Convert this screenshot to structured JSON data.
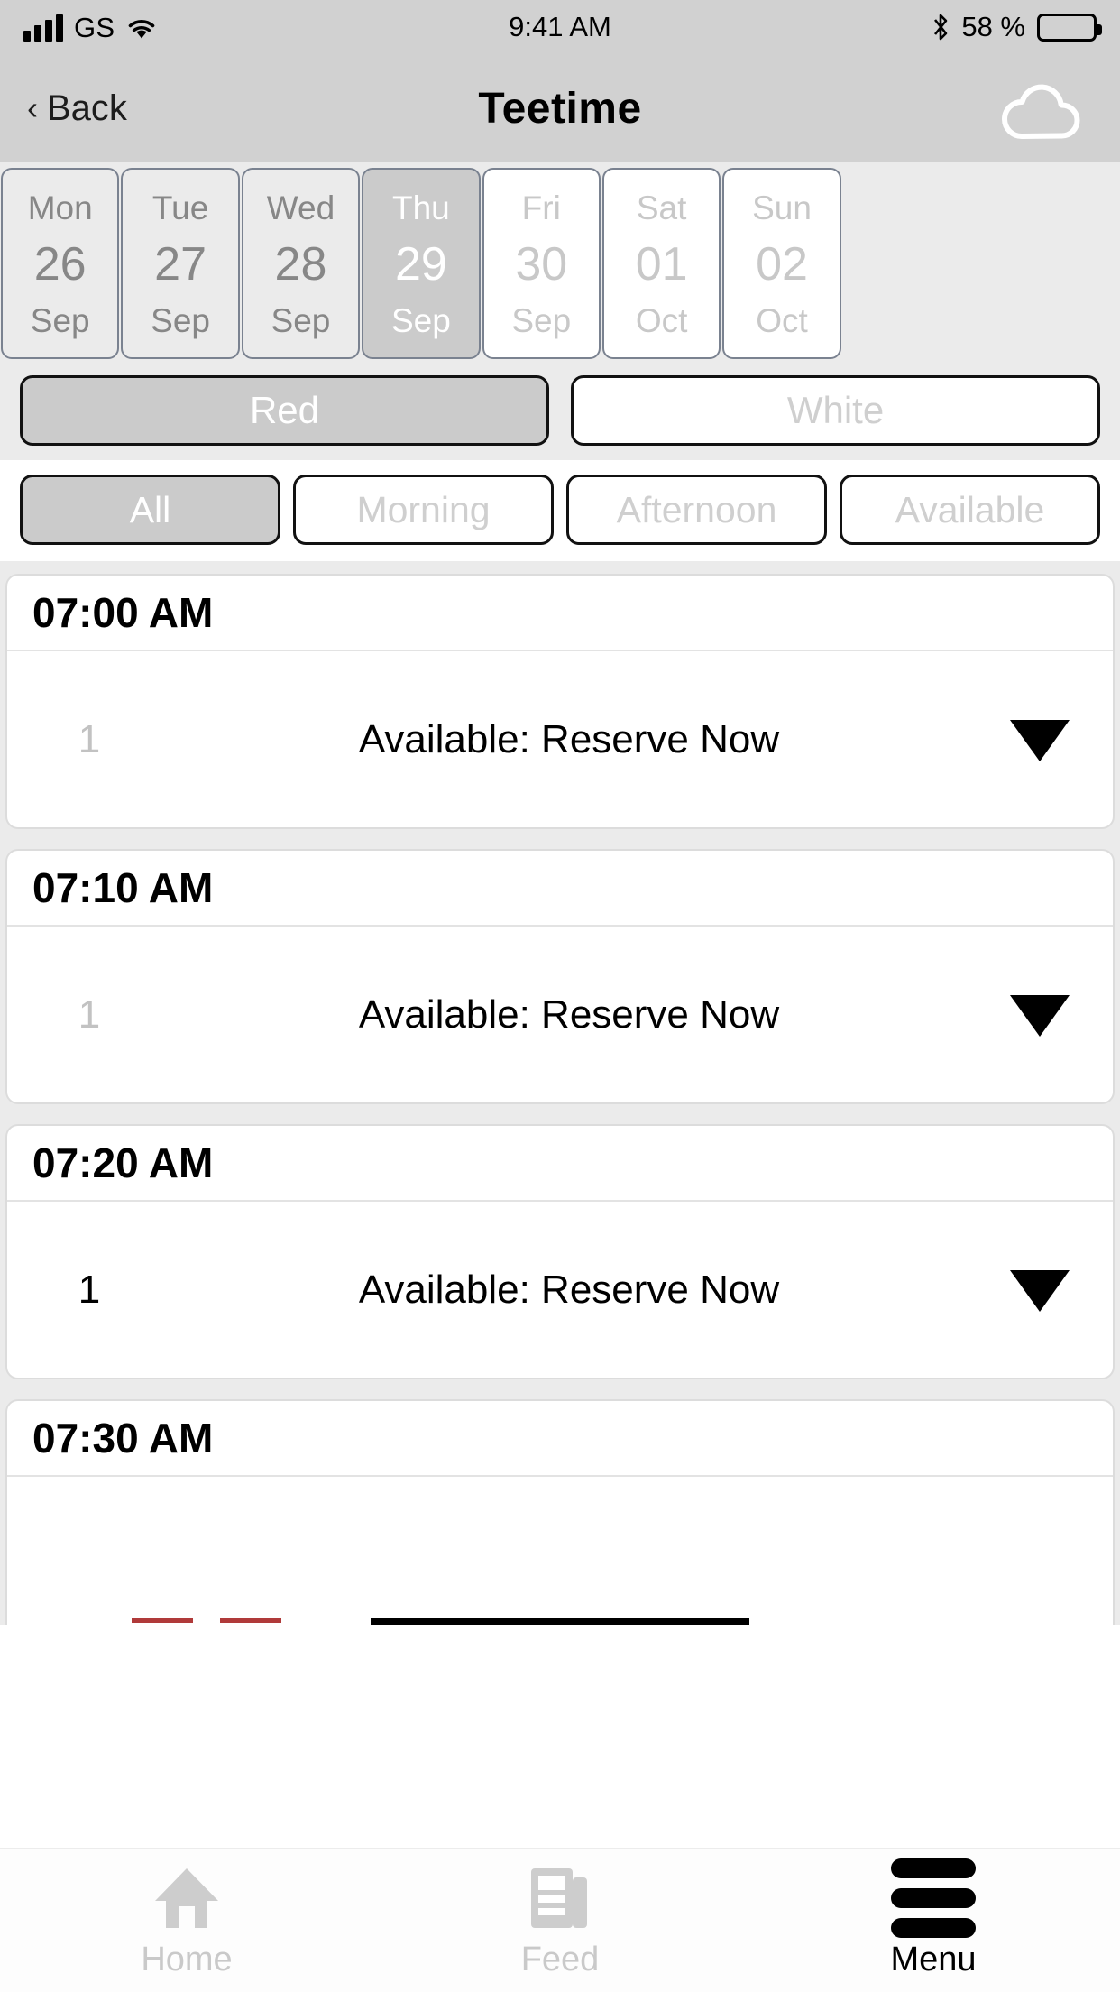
{
  "status_bar": {
    "carrier": "GS",
    "time": "9:41 AM",
    "battery_percent": "58 %",
    "signal_icon": "signal-bars-icon",
    "wifi_icon": "wifi-icon",
    "bluetooth_icon": "bluetooth-icon",
    "battery_icon": "battery-icon"
  },
  "nav": {
    "back_label": "Back",
    "back_chevron": "‹",
    "title": "Teetime",
    "right_icon": "cloud-icon"
  },
  "dates": [
    {
      "dow": "Mon",
      "day": "26",
      "month": "Sep",
      "state": "light"
    },
    {
      "dow": "Tue",
      "day": "27",
      "month": "Sep",
      "state": "light"
    },
    {
      "dow": "Wed",
      "day": "28",
      "month": "Sep",
      "state": "light"
    },
    {
      "dow": "Thu",
      "day": "29",
      "month": "Sep",
      "state": "selected"
    },
    {
      "dow": "Fri",
      "day": "30",
      "month": "Sep",
      "state": "dim"
    },
    {
      "dow": "Sat",
      "day": "01",
      "month": "Oct",
      "state": "dim"
    },
    {
      "dow": "Sun",
      "day": "02",
      "month": "Oct",
      "state": "dim"
    }
  ],
  "course_toggle": {
    "options": [
      {
        "label": "Red",
        "selected": true
      },
      {
        "label": "White",
        "selected": false
      }
    ]
  },
  "filters": {
    "options": [
      {
        "label": "All",
        "selected": true
      },
      {
        "label": "Morning",
        "selected": false
      },
      {
        "label": "Afternoon",
        "selected": false
      },
      {
        "label": "Available",
        "selected": false
      }
    ]
  },
  "teetimes": [
    {
      "time": "07:00 AM",
      "slot": "1",
      "slot_muted": true,
      "status": "Available: Reserve Now",
      "caret": "chevron-down-icon"
    },
    {
      "time": "07:10 AM",
      "slot": "1",
      "slot_muted": true,
      "status": "Available: Reserve Now",
      "caret": "chevron-down-icon"
    },
    {
      "time": "07:20 AM",
      "slot": "1",
      "slot_muted": false,
      "status": "Available: Reserve Now",
      "caret": "chevron-down-icon"
    },
    {
      "time": "07:30 AM",
      "slot": "",
      "slot_muted": true,
      "status": "",
      "caret": ""
    }
  ],
  "tabbar": {
    "tabs": [
      {
        "label": "Home",
        "icon": "home-icon",
        "active": false
      },
      {
        "label": "Feed",
        "icon": "feed-icon",
        "active": false
      },
      {
        "label": "Menu",
        "icon": "hamburger-menu-icon",
        "active": true
      }
    ]
  },
  "colors": {
    "chrome": "#d1d1d1",
    "page_bg": "#ebebeb",
    "selected_fill": "#cbcbcb",
    "muted_text": "#c8c8c8",
    "accent_red": "#b03a3a"
  }
}
